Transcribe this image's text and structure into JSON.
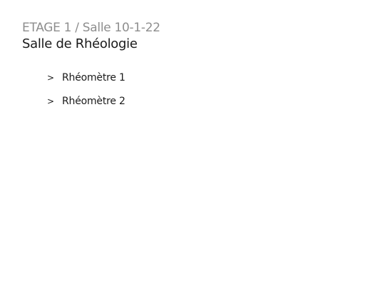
{
  "header": {
    "location": "ETAGE 1 / Salle 10-1-22",
    "room_title": "Salle de Rhéologie"
  },
  "devices": [
    {
      "icon": "chevron-right-icon",
      "marker": ">",
      "label": "Rhéomètre 1"
    },
    {
      "icon": "chevron-right-icon",
      "marker": ">",
      "label": "Rhéomètre 2"
    }
  ]
}
